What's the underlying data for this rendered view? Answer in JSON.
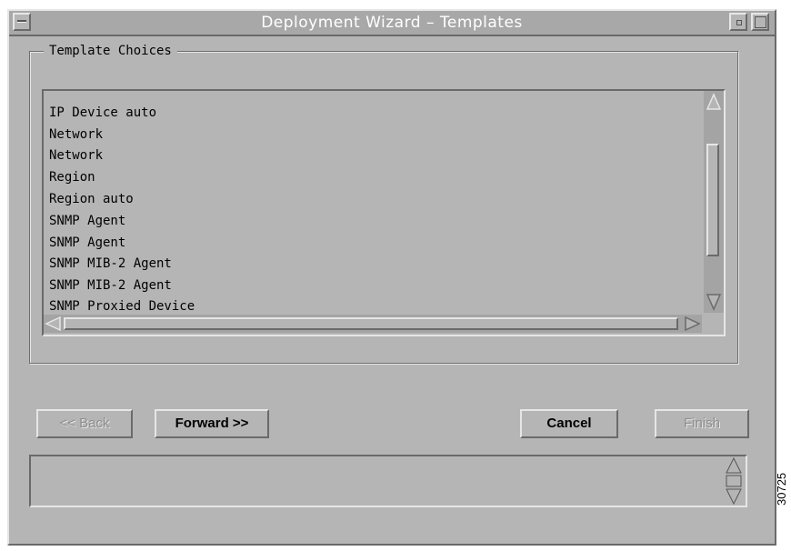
{
  "window": {
    "title": "Deployment Wizard – Templates"
  },
  "group": {
    "label": "Template Choices"
  },
  "list": {
    "items": [
      "IP Device auto",
      "Network",
      "Network",
      "Region",
      "Region auto",
      "SNMP Agent",
      "SNMP Agent",
      "SNMP MIB-2 Agent",
      "SNMP MIB-2 Agent",
      "SNMP Proxied Device"
    ]
  },
  "buttons": {
    "back": "<< Back",
    "forward": "Forward >>",
    "cancel": "Cancel",
    "finish": "Finish"
  },
  "figure_code": "30725",
  "colors": {
    "window_bg": "#b5b5b5",
    "title_text": "#ffffff",
    "disabled_text": "#8e8e8e"
  }
}
